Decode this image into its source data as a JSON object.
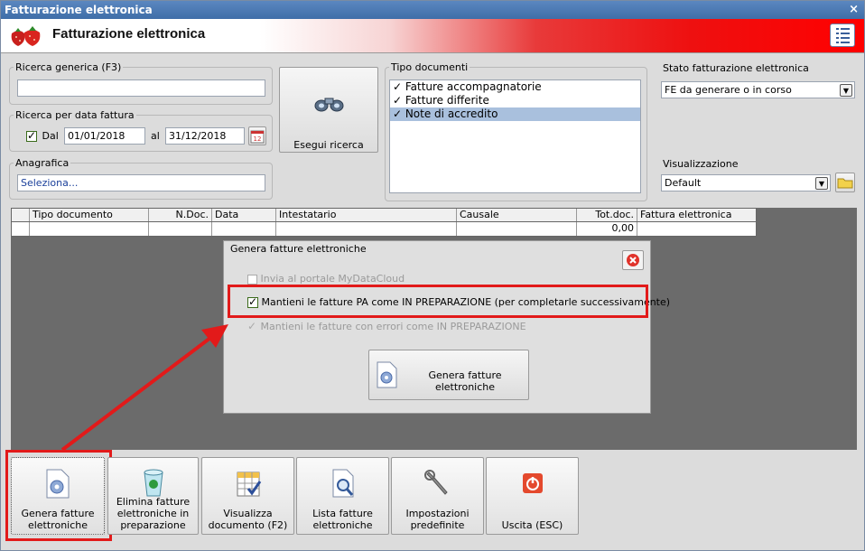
{
  "window": {
    "title": "Fatturazione elettronica",
    "close": "×"
  },
  "header": {
    "title": "Fatturazione elettronica"
  },
  "search": {
    "generic_label": "Ricerca generica (F3)",
    "generic_value": "",
    "date_label": "Ricerca per data fattura",
    "dal_label": "Dal",
    "dal_checked": true,
    "from": "01/01/2018",
    "al_label": "al",
    "to": "31/12/2018",
    "anagrafica_label": "Anagrafica",
    "anagrafica_value": "Seleziona...",
    "search_button": "Esegui ricerca"
  },
  "doc_types": {
    "label": "Tipo documenti",
    "items": [
      {
        "label": "Fatture accompagnatorie",
        "checked": true
      },
      {
        "label": "Fatture differite",
        "checked": true
      },
      {
        "label": "Note di accredito",
        "checked": true
      }
    ]
  },
  "status": {
    "label": "Stato fatturazione elettronica",
    "value": "FE da generare o in corso"
  },
  "view": {
    "label": "Visualizzazione",
    "value": "Default"
  },
  "grid": {
    "columns": [
      "Tipo documento",
      "N.Doc.",
      "Data",
      "Intestatario",
      "Causale",
      "Tot.doc.",
      "Fattura elettronica"
    ],
    "total": "0,00"
  },
  "dialog": {
    "title": "Genera fatture elettroniche",
    "options": [
      {
        "label": "Invia al portale MyDataCloud",
        "enabled": false,
        "checked": false
      },
      {
        "label": "Mantieni le fatture PA come IN PREPARAZIONE (per completarle successivamente)",
        "enabled": true,
        "checked": true
      },
      {
        "label": "Mantieni le fatture con errori come IN PREPARAZIONE",
        "enabled": false,
        "checked": true
      }
    ],
    "generate_button": "Genera fatture elettroniche"
  },
  "toolbar": {
    "genera": "Genera fatture elettroniche",
    "elimina": "Elimina fatture elettroniche in preparazione",
    "visualizza": "Visualizza documento (F2)",
    "lista": "Lista fatture elettroniche",
    "impostazioni": "Impostazioni predefinite",
    "uscita": "Uscita (ESC)"
  },
  "colors": {
    "highlight": "#e21a1a",
    "selection": "#a9c0dd",
    "title_bar": "#3f6ea8"
  }
}
